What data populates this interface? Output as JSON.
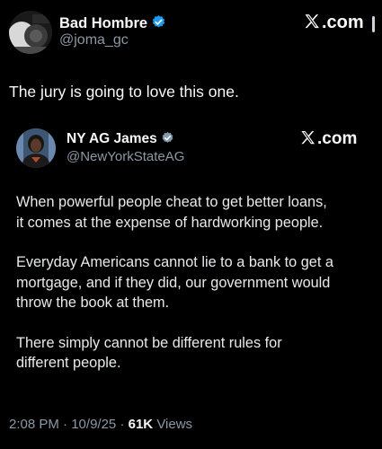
{
  "post": {
    "author_name": "Bad Hombre",
    "author_handle": "@joma_gc",
    "source_label": ".com",
    "text": "The jury is going to love this one."
  },
  "quoted_post": {
    "author_name": "NY AG James",
    "author_handle": "@NewYorkStateAG",
    "source_label": ".com",
    "paragraphs": [
      "When powerful people cheat to get better loans,\nit comes at the expense of hardworking people.",
      "Everyday Americans cannot lie to a bank to get a\nmortgage, and if they did, our government would\nthrow the book at them.",
      "There simply cannot be different rules for\ndifferent people."
    ]
  },
  "meta": {
    "time": "2:08 PM",
    "date": "10/9/25",
    "separator": "·",
    "views_count": "61K",
    "views_label": "Views"
  },
  "colors": {
    "background": "#000000",
    "text_primary": "#f7f9f9",
    "text_secondary": "#8b98a5",
    "verified_blue": "#1d9bf0",
    "verified_gray": "#829aab"
  },
  "icons": {
    "outer_badge": "verified-blue-icon",
    "quote_badge": "verified-gray-icon",
    "x_logo": "x-logo-icon"
  }
}
